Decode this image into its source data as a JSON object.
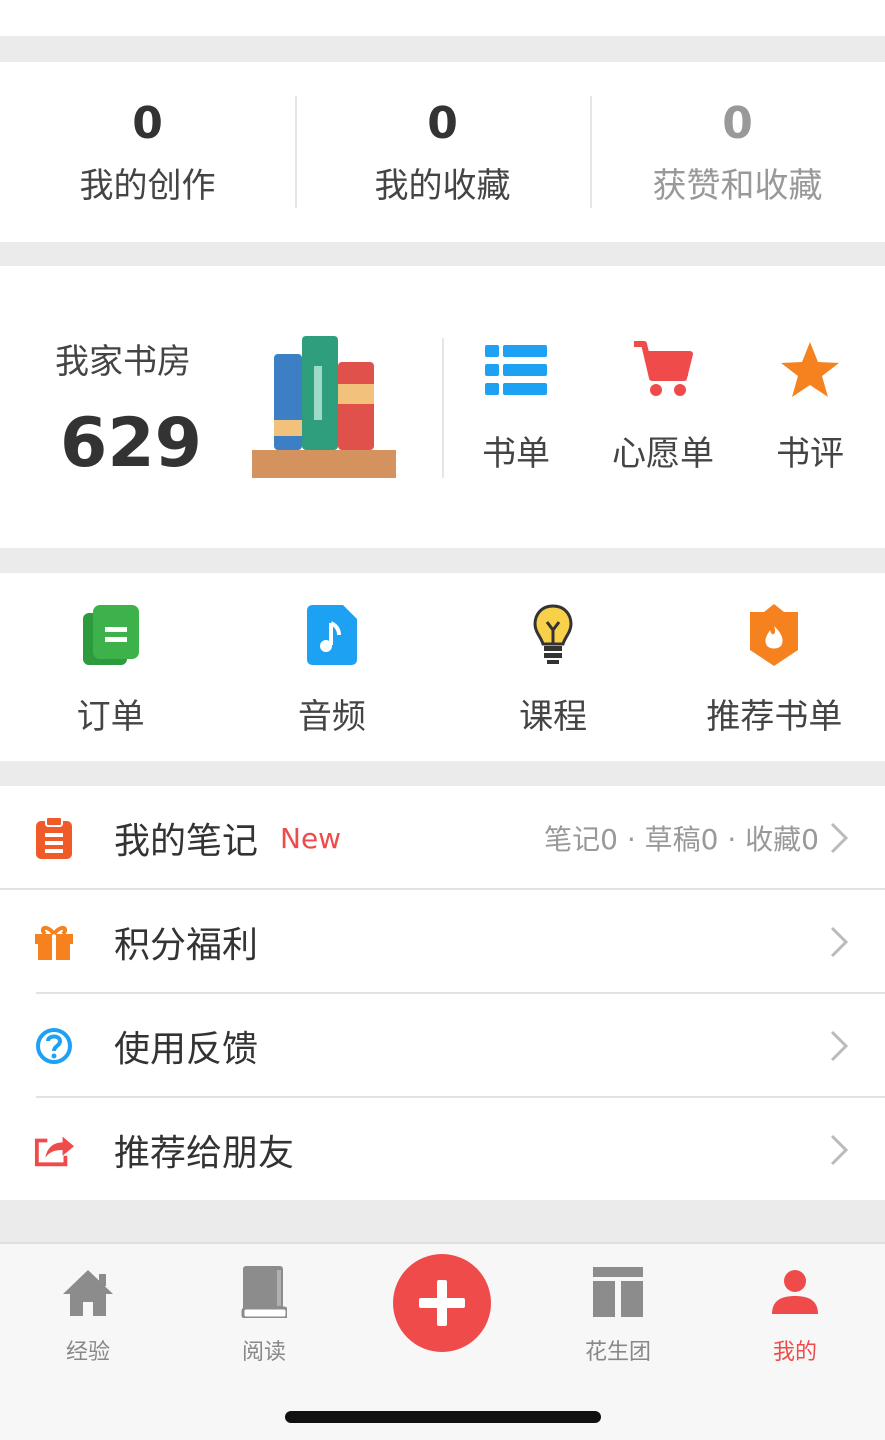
{
  "stats": [
    {
      "value": "0",
      "label": "我的创作"
    },
    {
      "value": "0",
      "label": "我的收藏"
    },
    {
      "value": "0",
      "label": "获赞和收藏"
    }
  ],
  "study": {
    "title": "我家书房",
    "count": "629",
    "actions": [
      {
        "label": "书单",
        "icon": "list-icon"
      },
      {
        "label": "心愿单",
        "icon": "cart-icon"
      },
      {
        "label": "书评",
        "icon": "star-icon"
      }
    ]
  },
  "services": [
    {
      "label": "订单",
      "icon": "order-icon"
    },
    {
      "label": "音频",
      "icon": "audio-icon"
    },
    {
      "label": "课程",
      "icon": "lightbulb-icon"
    },
    {
      "label": "推荐书单",
      "icon": "fire-badge-icon"
    }
  ],
  "list": {
    "notes": {
      "label": "我的笔记",
      "badge": "New",
      "meta": "笔记0 · 草稿0 · 收藏0"
    },
    "points": {
      "label": "积分福利"
    },
    "feedback": {
      "label": "使用反馈"
    },
    "share": {
      "label": "推荐给朋友"
    }
  },
  "tabbar": {
    "tabs": [
      {
        "label": "经验"
      },
      {
        "label": "阅读"
      },
      {
        "label": "花生团"
      },
      {
        "label": "我的"
      }
    ],
    "active": "我的"
  },
  "colors": {
    "accent": "#f04b4b",
    "blue": "#1da1f2",
    "orange": "#f5821f",
    "green": "#3db24b"
  }
}
